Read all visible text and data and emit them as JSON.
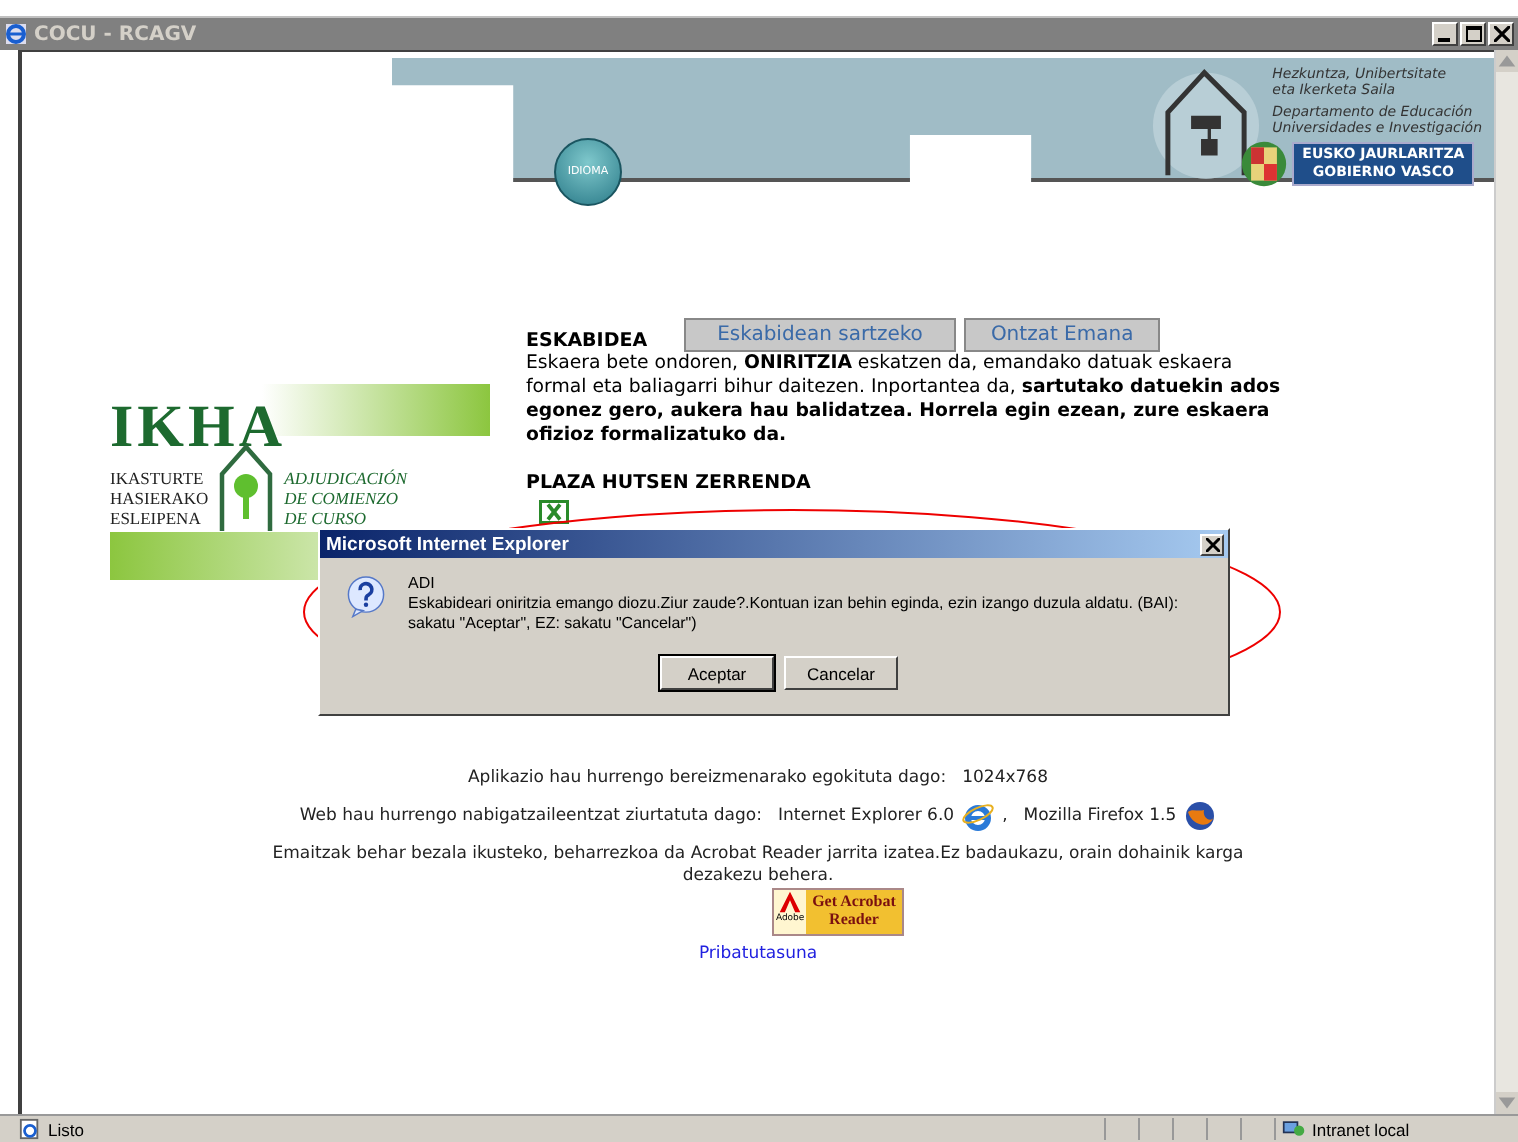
{
  "window": {
    "title": "COCU - RCAGV"
  },
  "header": {
    "language_button": "IDIOMA",
    "department_eu": [
      "Hezkuntza, Unibertsitate",
      "eta Ikerketa Saila"
    ],
    "department_es": [
      "Departamento de Educación",
      "Universidades e Investigación"
    ],
    "government": [
      "EUSKO JAURLARITZA",
      "GOBIERNO VASCO"
    ]
  },
  "logo": {
    "title": "IKHA",
    "lines_eu": [
      "IKASTURTE",
      "HASIERAKO",
      "ESLEIPENA"
    ],
    "lines_es": [
      "ADJUDICACIÓN",
      "DE COMIENZO",
      "DE CURSO"
    ]
  },
  "application": {
    "heading": "ESKABIDEA",
    "buttons": [
      "Eskabidean sartzeko",
      "Ontzat Emana"
    ],
    "text": "Eskaera bete ondoren, **ONIRITZIA** eskatzen da, emandako datuak eskaera formal eta baliagarri bihur daitezen. Inportantea da, **sartutako datuekin ados egonez gero, aukera hau balidatzea. Horrela egin ezean, zure eskaera ofizioz formalizatuko da.**",
    "list_heading": "PLAZA HUTSEN ZERRENDA"
  },
  "footer": {
    "resolution_label": "Aplikazio hau hurrengo bereizmenarako egokituta dago:",
    "resolution_value": "1024x768",
    "browsers_label": "Web hau hurrengo nabigatzaileentzat ziurtatuta dago:",
    "browser_1": "Internet Explorer 6.0",
    "separator": ",",
    "browser_2": "Mozilla Firefox 1.5",
    "acrobat_text": "Emaitzak behar bezala ikusteko, beharrezkoa da Acrobat Reader jarrita izatea.Ez badaukazu, orain dohainik karga dezakezu behera.",
    "acrobat_badge": {
      "brand": "Adobe",
      "lines": [
        "Get Acrobat",
        "Reader"
      ]
    },
    "privacy_link": "Pribatutasuna"
  },
  "dialog": {
    "title": "Microsoft Internet Explorer",
    "heading": "ADI",
    "message": "Eskabideari oniritzia emango diozu.Ziur zaude?.Kontuan izan behin eginda, ezin izango duzula aldatu. (BAI): sakatu \"Aceptar\", EZ: sakatu \"Cancelar\")",
    "buttons": [
      "Aceptar",
      "Cancelar"
    ]
  },
  "status_bar": {
    "text": "Listo",
    "zone": "Intranet local"
  }
}
